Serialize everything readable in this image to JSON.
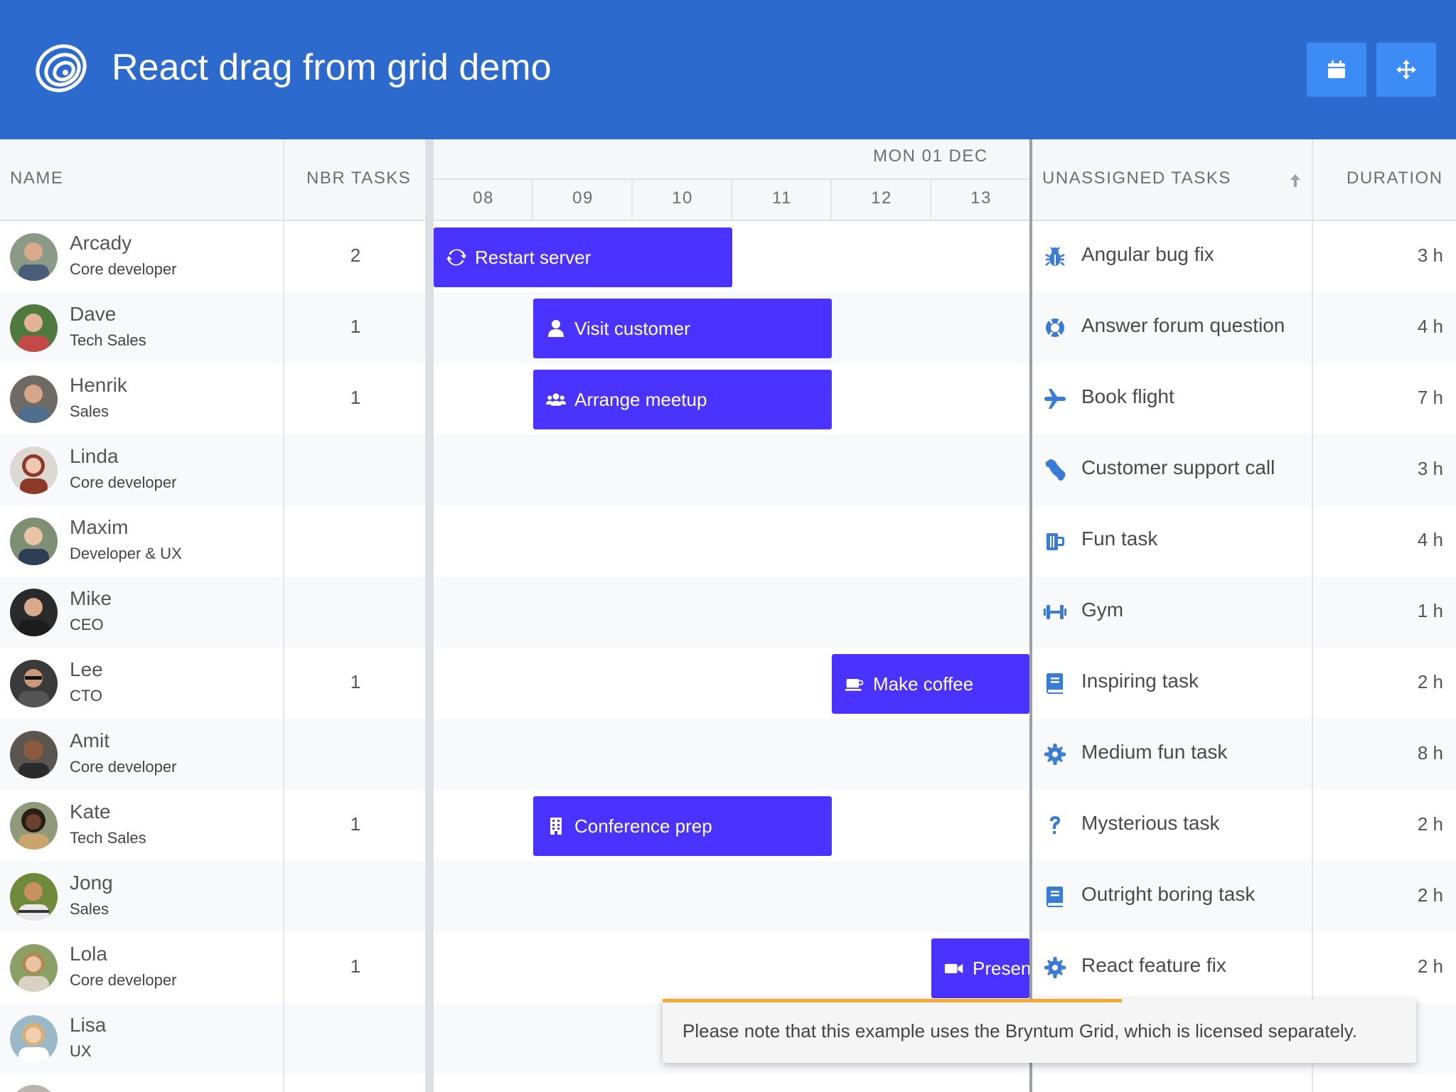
{
  "app": {
    "title": "React drag from grid demo"
  },
  "header_buttons": [
    {
      "icon": "calendar-icon"
    },
    {
      "icon": "move-icon"
    }
  ],
  "grid": {
    "col_name": "NAME",
    "col_tasks": "NBR TASKS"
  },
  "timeline": {
    "date_label": "MON 01 DEC",
    "hours": [
      "08",
      "09",
      "10",
      "11",
      "12",
      "13"
    ]
  },
  "unassigned": {
    "col_task": "UNASSIGNED TASKS",
    "col_duration": "DURATION",
    "sort_icon": "arrow-up-icon"
  },
  "resources": [
    {
      "name": "Arcady",
      "role": "Core developer",
      "count": "2"
    },
    {
      "name": "Dave",
      "role": "Tech Sales",
      "count": "1"
    },
    {
      "name": "Henrik",
      "role": "Sales",
      "count": "1"
    },
    {
      "name": "Linda",
      "role": "Core developer",
      "count": ""
    },
    {
      "name": "Maxim",
      "role": "Developer & UX",
      "count": ""
    },
    {
      "name": "Mike",
      "role": "CEO",
      "count": ""
    },
    {
      "name": "Lee",
      "role": "CTO",
      "count": "1"
    },
    {
      "name": "Amit",
      "role": "Core developer",
      "count": ""
    },
    {
      "name": "Kate",
      "role": "Tech Sales",
      "count": "1"
    },
    {
      "name": "Jong",
      "role": "Sales",
      "count": ""
    },
    {
      "name": "Lola",
      "role": "Core developer",
      "count": "1"
    },
    {
      "name": "Lisa",
      "role": "UX",
      "count": ""
    }
  ],
  "events": [
    {
      "label": "Restart server",
      "icon": "refresh-icon"
    },
    {
      "label": "Visit customer",
      "icon": "user-icon"
    },
    {
      "label": "Arrange meetup",
      "icon": "users-icon"
    },
    {
      "label": "Make coffee",
      "icon": "coffee-icon"
    },
    {
      "label": "Conference prep",
      "icon": "building-icon"
    },
    {
      "label": "Presen",
      "icon": "video-icon"
    }
  ],
  "tasks": [
    {
      "name": "Angular bug fix",
      "duration": "3 h",
      "icon": "bug-icon"
    },
    {
      "name": "Answer forum question",
      "duration": "4 h",
      "icon": "life-ring-icon"
    },
    {
      "name": "Book flight",
      "duration": "7 h",
      "icon": "plane-icon"
    },
    {
      "name": "Customer support call",
      "duration": "3 h",
      "icon": "phone-icon"
    },
    {
      "name": "Fun task",
      "duration": "4 h",
      "icon": "beer-icon"
    },
    {
      "name": "Gym",
      "duration": "1 h",
      "icon": "dumbbell-icon"
    },
    {
      "name": "Inspiring task",
      "duration": "2 h",
      "icon": "book-icon"
    },
    {
      "name": "Medium fun task",
      "duration": "8 h",
      "icon": "cog-icon"
    },
    {
      "name": "Mysterious task",
      "duration": "2 h",
      "icon": "question-icon"
    },
    {
      "name": "Outright boring task",
      "duration": "2 h",
      "icon": "book-icon"
    },
    {
      "name": "React feature fix",
      "duration": "2 h",
      "icon": "cog-icon"
    }
  ],
  "toast": {
    "message": "Please note that this example uses the Bryntum Grid, which is licensed separately."
  },
  "colors": {
    "header": "#2c6bcd",
    "header_button": "#3d8bf5",
    "event": "#4a32ff",
    "task_icon": "#3a7bd5",
    "toast_accent": "#f5a833"
  }
}
